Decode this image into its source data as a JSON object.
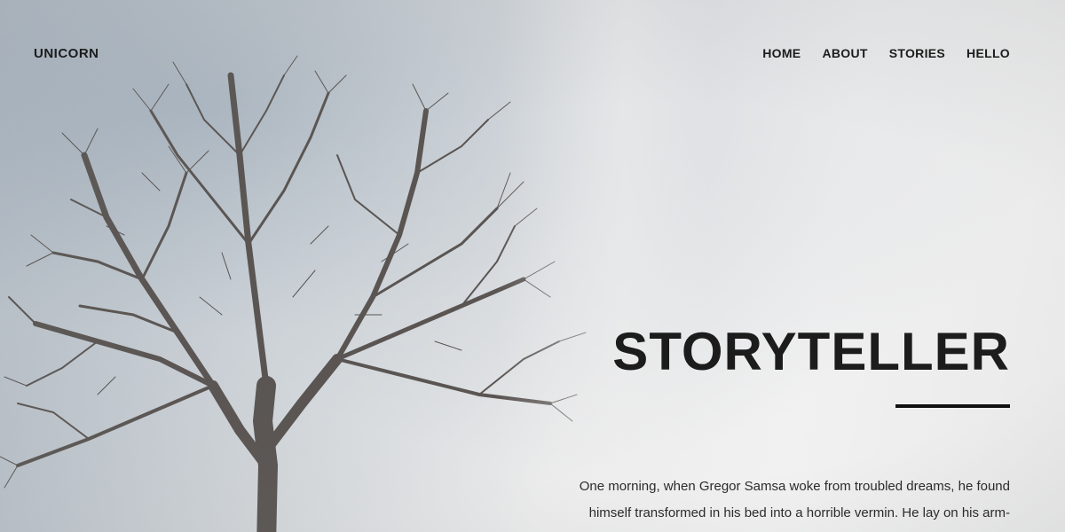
{
  "header": {
    "brand": "UNICORN",
    "nav": [
      {
        "label": "HOME"
      },
      {
        "label": "ABOUT"
      },
      {
        "label": "STORIES"
      },
      {
        "label": "HELLO"
      }
    ]
  },
  "hero": {
    "title": "STORYTELLER",
    "text": "One morning, when Gregor Samsa woke from troubled dreams, he found himself transformed in his bed into a horrible vermin. He lay on his arm-"
  },
  "colors": {
    "text": "#1c1c1c",
    "accent_rule": "#111111"
  },
  "background_image": "bare-tree-in-fog"
}
